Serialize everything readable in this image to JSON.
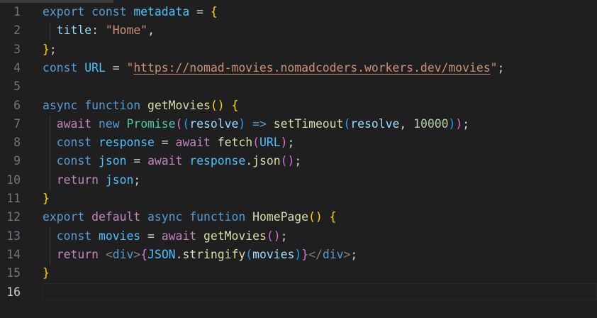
{
  "editor": {
    "current_line": 16,
    "lines": [
      {
        "n": "1",
        "tokens": [
          [
            "kw",
            "export"
          ],
          [
            "pun",
            " "
          ],
          [
            "kw",
            "const"
          ],
          [
            "pun",
            " "
          ],
          [
            "cst",
            "metadata"
          ],
          [
            "pun",
            " = "
          ],
          [
            "b1",
            "{"
          ]
        ]
      },
      {
        "n": "2",
        "tokens": [
          [
            "pun",
            "  "
          ],
          [
            "var",
            "title"
          ],
          [
            "pun",
            ": "
          ],
          [
            "str",
            "\"Home\""
          ],
          [
            "pun",
            ","
          ]
        ]
      },
      {
        "n": "3",
        "tokens": [
          [
            "b1",
            "}"
          ],
          [
            "pun",
            ";"
          ]
        ]
      },
      {
        "n": "4",
        "tokens": [
          [
            "kw",
            "const"
          ],
          [
            "pun",
            " "
          ],
          [
            "cst",
            "URL"
          ],
          [
            "pun",
            " = "
          ],
          [
            "str",
            "\""
          ],
          [
            "url",
            "https://nomad-movies.nomadcoders.workers.dev/movies"
          ],
          [
            "str",
            "\""
          ],
          [
            "pun",
            ";"
          ]
        ]
      },
      {
        "n": "5",
        "tokens": []
      },
      {
        "n": "6",
        "tokens": [
          [
            "kw",
            "async"
          ],
          [
            "pun",
            " "
          ],
          [
            "kw",
            "function"
          ],
          [
            "pun",
            " "
          ],
          [
            "fn",
            "getMovies"
          ],
          [
            "b1",
            "()"
          ],
          [
            "pun",
            " "
          ],
          [
            "b1",
            "{"
          ]
        ]
      },
      {
        "n": "7",
        "tokens": [
          [
            "pun",
            "  "
          ],
          [
            "ctl",
            "await"
          ],
          [
            "pun",
            " "
          ],
          [
            "kw",
            "new"
          ],
          [
            "pun",
            " "
          ],
          [
            "typ",
            "Promise"
          ],
          [
            "b2",
            "("
          ],
          [
            "b3",
            "("
          ],
          [
            "var",
            "resolve"
          ],
          [
            "b3",
            ")"
          ],
          [
            "pun",
            " "
          ],
          [
            "kw",
            "=>"
          ],
          [
            "pun",
            " "
          ],
          [
            "fn",
            "setTimeout"
          ],
          [
            "b3",
            "("
          ],
          [
            "var",
            "resolve"
          ],
          [
            "pun",
            ", "
          ],
          [
            "num",
            "10000"
          ],
          [
            "b3",
            ")"
          ],
          [
            "b2",
            ")"
          ],
          [
            "pun",
            ";"
          ]
        ]
      },
      {
        "n": "8",
        "tokens": [
          [
            "pun",
            "  "
          ],
          [
            "kw",
            "const"
          ],
          [
            "pun",
            " "
          ],
          [
            "cst",
            "response"
          ],
          [
            "pun",
            " = "
          ],
          [
            "ctl",
            "await"
          ],
          [
            "pun",
            " "
          ],
          [
            "fn",
            "fetch"
          ],
          [
            "b2",
            "("
          ],
          [
            "cst",
            "URL"
          ],
          [
            "b2",
            ")"
          ],
          [
            "pun",
            ";"
          ]
        ]
      },
      {
        "n": "9",
        "tokens": [
          [
            "pun",
            "  "
          ],
          [
            "kw",
            "const"
          ],
          [
            "pun",
            " "
          ],
          [
            "cst",
            "json"
          ],
          [
            "pun",
            " = "
          ],
          [
            "ctl",
            "await"
          ],
          [
            "pun",
            " "
          ],
          [
            "cst",
            "response"
          ],
          [
            "pun",
            "."
          ],
          [
            "fn",
            "json"
          ],
          [
            "b2",
            "()"
          ],
          [
            "pun",
            ";"
          ]
        ]
      },
      {
        "n": "10",
        "tokens": [
          [
            "pun",
            "  "
          ],
          [
            "ctl",
            "return"
          ],
          [
            "pun",
            " "
          ],
          [
            "cst",
            "json"
          ],
          [
            "pun",
            ";"
          ]
        ]
      },
      {
        "n": "11",
        "tokens": [
          [
            "b1",
            "}"
          ]
        ]
      },
      {
        "n": "12",
        "tokens": [
          [
            "kw",
            "export"
          ],
          [
            "pun",
            " "
          ],
          [
            "ctl",
            "default"
          ],
          [
            "pun",
            " "
          ],
          [
            "kw",
            "async"
          ],
          [
            "pun",
            " "
          ],
          [
            "kw",
            "function"
          ],
          [
            "pun",
            " "
          ],
          [
            "fn",
            "HomePage"
          ],
          [
            "b1",
            "()"
          ],
          [
            "pun",
            " "
          ],
          [
            "b1",
            "{"
          ]
        ]
      },
      {
        "n": "13",
        "tokens": [
          [
            "pun",
            "  "
          ],
          [
            "kw",
            "const"
          ],
          [
            "pun",
            " "
          ],
          [
            "cst",
            "movies"
          ],
          [
            "pun",
            " = "
          ],
          [
            "ctl",
            "await"
          ],
          [
            "pun",
            " "
          ],
          [
            "fn",
            "getMovies"
          ],
          [
            "b2",
            "()"
          ],
          [
            "pun",
            ";"
          ]
        ]
      },
      {
        "n": "14",
        "tokens": [
          [
            "pun",
            "  "
          ],
          [
            "ctl",
            "return"
          ],
          [
            "pun",
            " "
          ],
          [
            "tag",
            "<"
          ],
          [
            "kw",
            "div"
          ],
          [
            "tag",
            ">"
          ],
          [
            "b2",
            "{"
          ],
          [
            "cst",
            "JSON"
          ],
          [
            "pun",
            "."
          ],
          [
            "fn",
            "stringify"
          ],
          [
            "b3",
            "("
          ],
          [
            "var",
            "movies"
          ],
          [
            "b3",
            ")"
          ],
          [
            "b2",
            "}"
          ],
          [
            "tag",
            "</"
          ],
          [
            "kw",
            "div"
          ],
          [
            "tag",
            ">"
          ],
          [
            "pun",
            ";"
          ]
        ]
      },
      {
        "n": "15",
        "tokens": [
          [
            "b1",
            "}"
          ]
        ]
      },
      {
        "n": "16",
        "tokens": []
      }
    ]
  }
}
